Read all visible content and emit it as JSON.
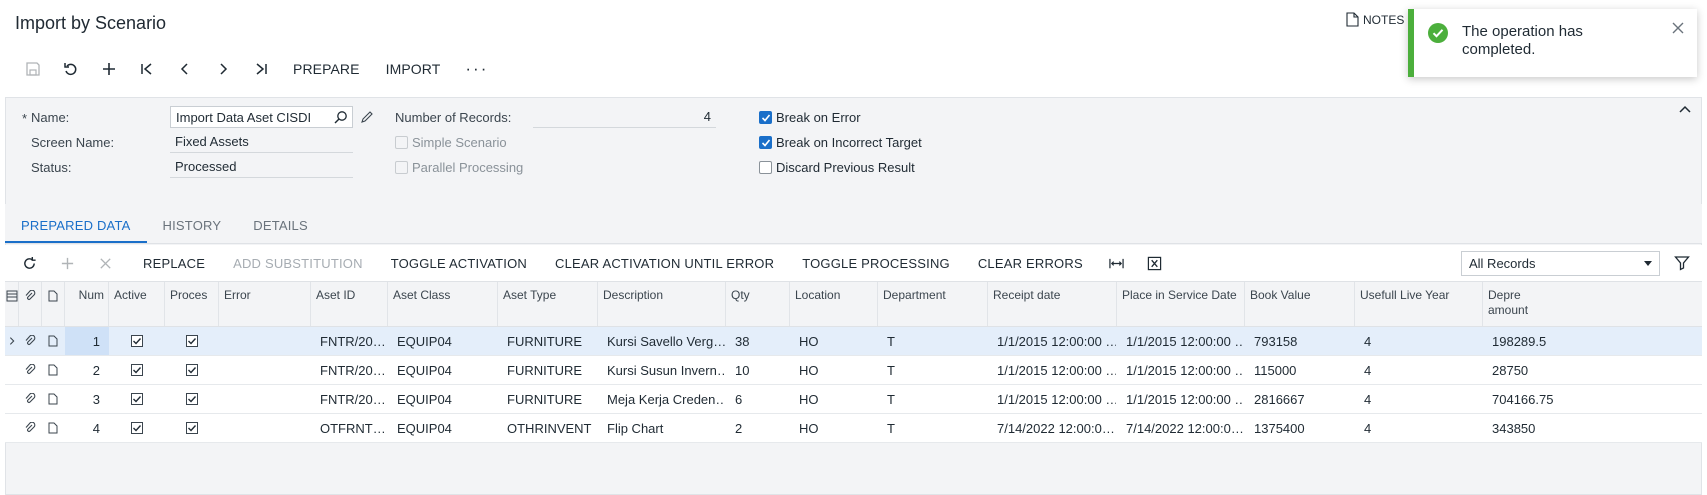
{
  "header": {
    "title": "Import by Scenario",
    "notes_label": "NOTES"
  },
  "toolbar": {
    "prepare_label": "PREPARE",
    "import_label": "IMPORT",
    "more_label": "···"
  },
  "toast": {
    "message": "The operation has completed.",
    "accent_color": "#4caf3c"
  },
  "form": {
    "name_label": "Name:",
    "name_required_mark": "*",
    "name_value": "Import Data Aset CISDI",
    "screen_name_label": "Screen Name:",
    "screen_name_value": "Fixed Assets",
    "status_label": "Status:",
    "status_value": "Processed",
    "num_records_label": "Number of Records:",
    "num_records_value": "4",
    "simple_scenario_label": "Simple Scenario",
    "parallel_processing_label": "Parallel Processing",
    "break_on_error_label": "Break on Error",
    "break_on_incorrect_target_label": "Break on Incorrect Target",
    "discard_previous_result_label": "Discard Previous Result"
  },
  "tabs": [
    {
      "label": "PREPARED DATA",
      "active": true
    },
    {
      "label": "HISTORY",
      "active": false
    },
    {
      "label": "DETAILS",
      "active": false
    }
  ],
  "grid_toolbar": {
    "replace_label": "REPLACE",
    "add_substitution_label": "ADD SUBSTITUTION",
    "toggle_activation_label": "TOGGLE ACTIVATION",
    "clear_activation_label": "CLEAR ACTIVATION UNTIL ERROR",
    "toggle_processing_label": "TOGGLE PROCESSING",
    "clear_errors_label": "CLEAR ERRORS",
    "records_filter_value": "All Records"
  },
  "grid": {
    "columns": {
      "num": "Num",
      "active": "Active",
      "processed": "Proces",
      "error": "Error",
      "asset_id": "Aset ID",
      "asset_class": "Aset Class",
      "asset_type": "Aset Type",
      "description": "Description",
      "qty": "Qty",
      "location": "Location",
      "department": "Department",
      "receipt_date": "Receipt date",
      "place_in_service_date": "Place in Service Date",
      "book_value": "Book Value",
      "useful_life": "Usefull Live Year",
      "depre_amount": "Depre amount"
    },
    "rows": [
      {
        "num": "1",
        "asset_id": "FNTR/20…",
        "asset_class": "EQUIP04",
        "asset_type": "FURNITURE",
        "description": "Kursi Savello Verg…",
        "qty": "38",
        "location": "HO",
        "department": "T",
        "receipt_date": "1/1/2015 12:00:00 …",
        "place_in_service_date": "1/1/2015 12:00:00 …",
        "book_value": "793158",
        "useful_life": "4",
        "depre_amount": "198289.5"
      },
      {
        "num": "2",
        "asset_id": "FNTR/20…",
        "asset_class": "EQUIP04",
        "asset_type": "FURNITURE",
        "description": "Kursi Susun Invern…",
        "qty": "10",
        "location": "HO",
        "department": "T",
        "receipt_date": "1/1/2015 12:00:00 …",
        "place_in_service_date": "1/1/2015 12:00:00 …",
        "book_value": "115000",
        "useful_life": "4",
        "depre_amount": "28750"
      },
      {
        "num": "3",
        "asset_id": "FNTR/20…",
        "asset_class": "EQUIP04",
        "asset_type": "FURNITURE",
        "description": "Meja Kerja Creden…",
        "qty": "6",
        "location": "HO",
        "department": "T",
        "receipt_date": "1/1/2015 12:00:00 …",
        "place_in_service_date": "1/1/2015 12:00:00 …",
        "book_value": "2816667",
        "useful_life": "4",
        "depre_amount": "704166.75"
      },
      {
        "num": "4",
        "asset_id": "OTFRNT…",
        "asset_class": "EQUIP04",
        "asset_type": "OTHRINVENT",
        "description": "Flip Chart",
        "qty": "2",
        "location": "HO",
        "department": "T",
        "receipt_date": "7/14/2022 12:00:0…",
        "place_in_service_date": "7/14/2022 12:00:0…",
        "book_value": "1375400",
        "useful_life": "4",
        "depre_amount": "343850"
      }
    ]
  }
}
